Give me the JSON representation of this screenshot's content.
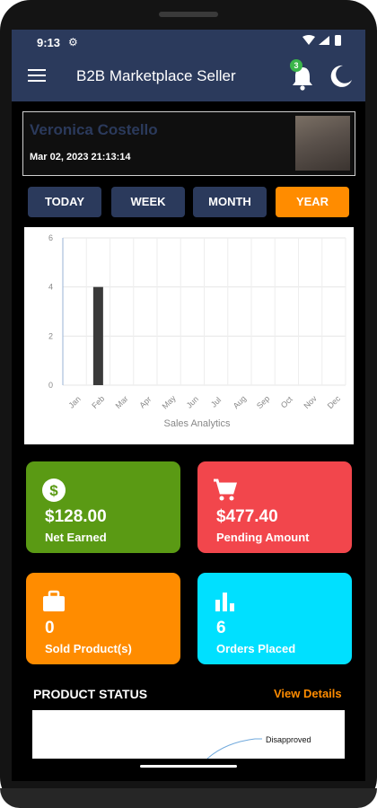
{
  "status_bar": {
    "time": "9:13"
  },
  "header": {
    "title": "B2B Marketplace Seller",
    "notification_count": "3",
    "icons": [
      "menu-icon",
      "bell-icon",
      "moon-icon"
    ]
  },
  "user": {
    "name": "Veronica Costello",
    "datetime": "Mar 02, 2023 21:13:14"
  },
  "period_tabs": [
    {
      "label": "TODAY",
      "active": false
    },
    {
      "label": "WEEK",
      "active": false
    },
    {
      "label": "MONTH",
      "active": false
    },
    {
      "label": "YEAR",
      "active": true
    }
  ],
  "chart_data": {
    "type": "bar",
    "categories": [
      "Jan",
      "Feb",
      "Mar",
      "Apr",
      "May",
      "Jun",
      "Jul",
      "Aug",
      "Sep",
      "Oct",
      "Nov",
      "Dec"
    ],
    "values": [
      0,
      4,
      0,
      0,
      0,
      0,
      0,
      0,
      0,
      0,
      0,
      0
    ],
    "xlabel": "Sales Analytics",
    "ylabel": "",
    "ylim": [
      0,
      6
    ],
    "yticks": [
      0,
      2,
      4,
      6
    ],
    "grid": true,
    "bar_color": "#3a3a3a"
  },
  "stats": [
    {
      "value": "$128.00",
      "label": "Net Earned",
      "icon": "dollar-icon",
      "color": "#5a9a14"
    },
    {
      "value": "$477.40",
      "label": "Pending Amount",
      "icon": "cart-icon",
      "color": "#f2464c"
    },
    {
      "value": "0",
      "label": "Sold Product(s)",
      "icon": "briefcase-icon",
      "color": "#ff8c00"
    },
    {
      "value": "6",
      "label": "Orders Placed",
      "icon": "bar-chart-icon",
      "color": "#00e0ff"
    }
  ],
  "product_status": {
    "title": "PRODUCT STATUS",
    "link": "View Details",
    "legend_label": "Disapproved"
  },
  "colors": {
    "primary": "#2b3a5c",
    "accent": "#ff8c00",
    "background": "#000000"
  }
}
